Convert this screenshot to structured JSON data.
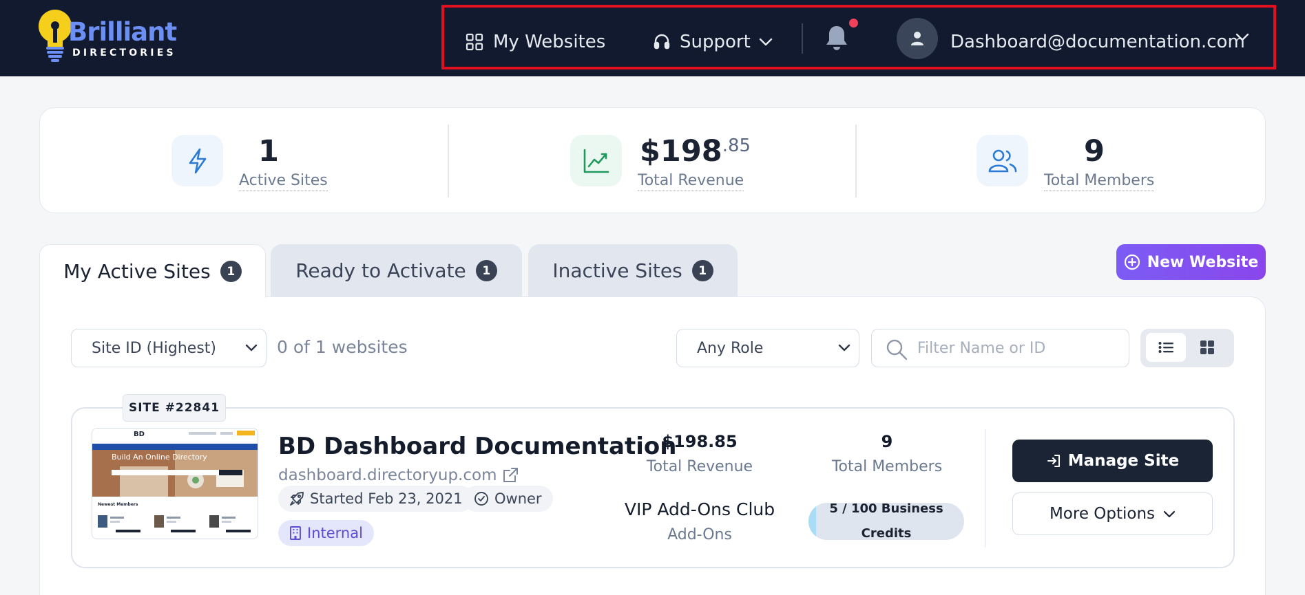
{
  "brand": {
    "name": "Brilliant",
    "sub": "DIRECTORIES"
  },
  "nav": {
    "my_websites": "My Websites",
    "support": "Support",
    "user_email": "Dashboard@documentation.com",
    "has_notification": true
  },
  "stats": {
    "active_sites": {
      "value": "1",
      "label": "Active Sites"
    },
    "total_revenue": {
      "dollars": "$198",
      "cents": ".85",
      "label": "Total Revenue"
    },
    "total_members": {
      "value": "9",
      "label": "Total Members"
    }
  },
  "tabs": [
    {
      "label": "My Active Sites",
      "count": "1",
      "active": true
    },
    {
      "label": "Ready to Activate",
      "count": "1",
      "active": false
    },
    {
      "label": "Inactive Sites",
      "count": "1",
      "active": false
    }
  ],
  "new_website_label": "New Website",
  "filters": {
    "sort_selected": "Site ID (Highest)",
    "result_count": "0 of 1 websites",
    "role_selected": "Any Role",
    "search_placeholder": "Filter Name or ID",
    "view_mode": "list"
  },
  "site": {
    "badge": "SITE #22841",
    "name": "BD Dashboard Documentation",
    "url": "dashboard.directoryup.com",
    "started": "Started Feb 23, 2021",
    "role": "Owner",
    "tag": "Internal",
    "revenue_value": "$198.85",
    "revenue_label": "Total Revenue",
    "members_value": "9",
    "members_label": "Total Members",
    "addon_value": "VIP Add-Ons Club",
    "addon_label": "Add-Ons",
    "credits_text": "5 / 100 Business Credits",
    "credits_fraction": 0.05,
    "manage_label": "Manage Site",
    "more_label": "More Options",
    "thumbnail": {
      "logo": "BD",
      "headline": "Build An Online Directory",
      "section": "Newest Members"
    }
  },
  "colors": {
    "header_bg": "#111a2e",
    "brand_blue": "#6c8ff5",
    "bulb_yellow": "#f5cf1c",
    "accent_purple": "#7c5cf5",
    "highlight_red": "#e10f1f",
    "notification_dot": "#f0405a"
  }
}
